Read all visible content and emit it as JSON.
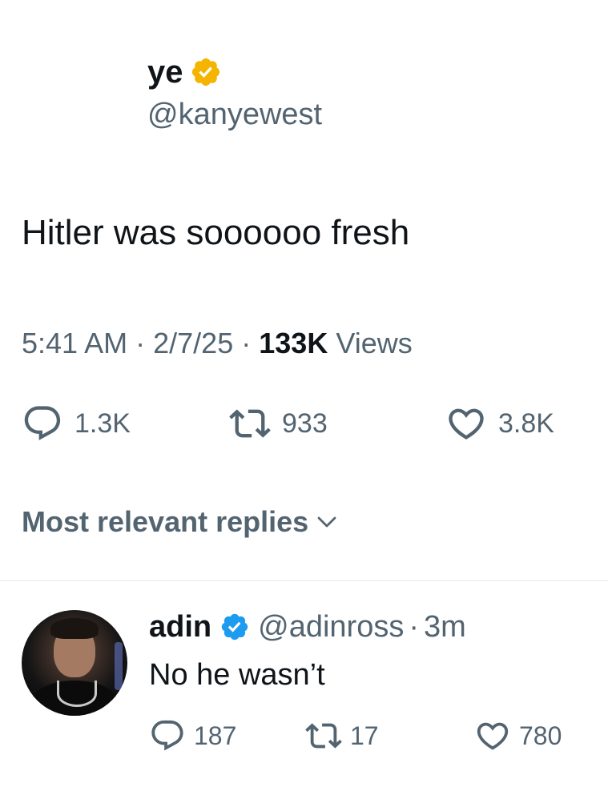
{
  "tweet": {
    "display_name": "ye",
    "handle": "@kanyewest",
    "text": "Hitler was soooooo fresh",
    "time": "5:41 AM",
    "separator": "·",
    "date": "2/7/25",
    "views_count": "133K",
    "views_label": "Views",
    "verified_badge_color": "#F4B400",
    "actions": {
      "replies": "1.3K",
      "reposts": "933",
      "likes": "3.8K"
    }
  },
  "replies_section": {
    "sort_label": "Most relevant replies",
    "icon": "chevron-down-icon"
  },
  "reply": {
    "display_name": "adin",
    "handle": "@adinross",
    "separator": "·",
    "time": "3m",
    "text": "No he wasn’t",
    "verified_badge_color": "#1D9BF0",
    "actions": {
      "replies": "187",
      "reposts": "17",
      "likes": "780"
    }
  },
  "colors": {
    "text_primary": "#0F1419",
    "text_secondary": "#536471",
    "divider": "#E6E9EB"
  }
}
